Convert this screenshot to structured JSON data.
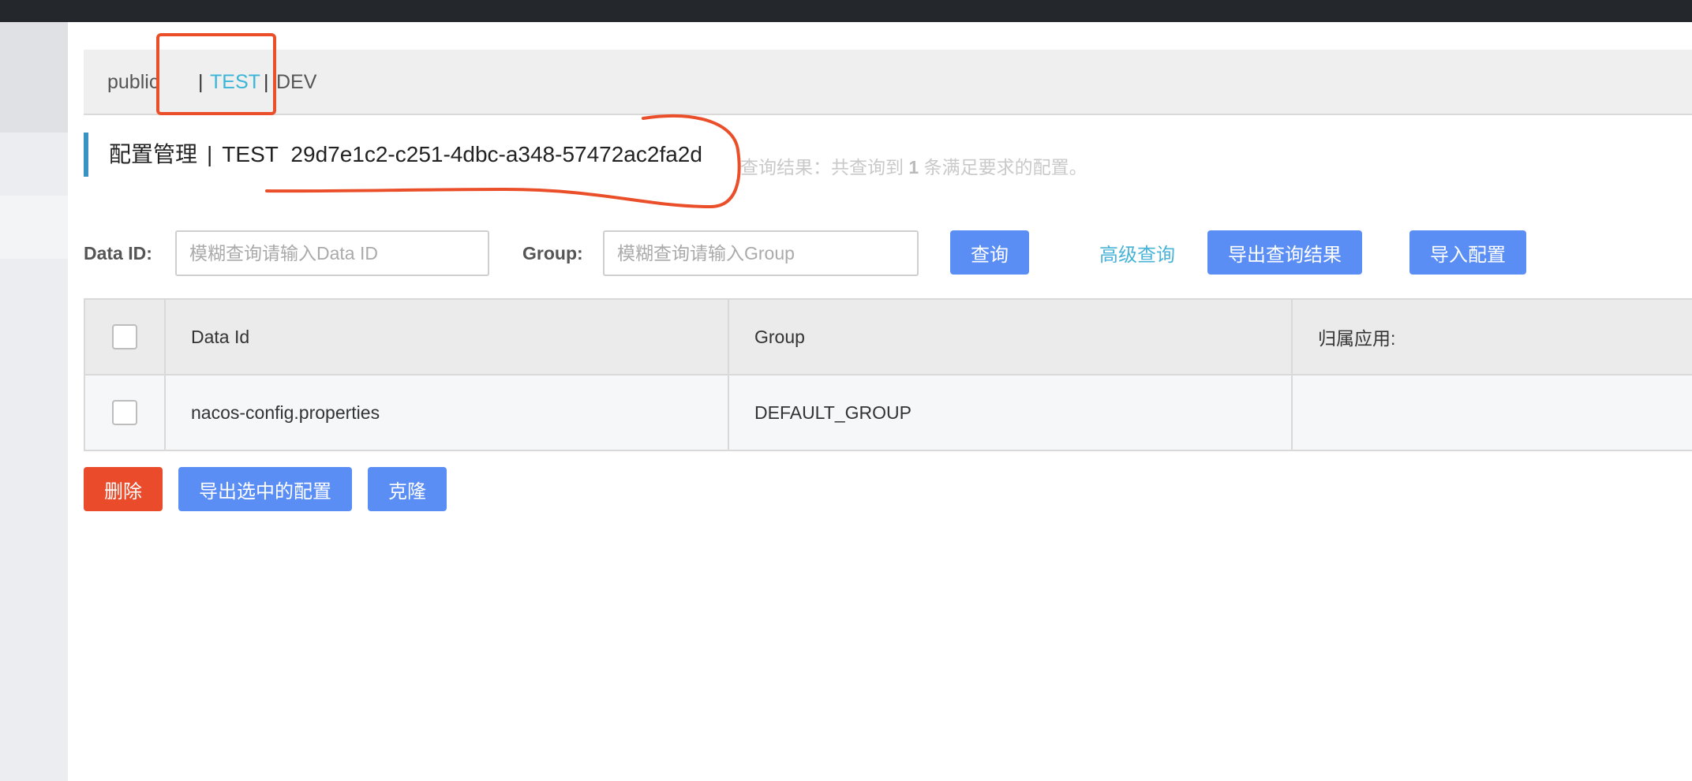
{
  "namespaces": [
    {
      "label": "public",
      "active": false
    },
    {
      "label": "TEST",
      "active": true
    },
    {
      "label": "DEV",
      "active": false
    }
  ],
  "namespace_separator": "|",
  "page_title": {
    "section": "配置管理",
    "separator": "|",
    "namespace": "TEST",
    "namespace_id": "29d7e1c2-c251-4dbc-a348-57472ac2fa2d"
  },
  "query_result": {
    "prefix": "查询结果：共查询到",
    "count": "1",
    "suffix": "条满足要求的配置。"
  },
  "search": {
    "data_id_label": "Data ID:",
    "data_id_placeholder": "模糊查询请输入Data ID",
    "group_label": "Group:",
    "group_placeholder": "模糊查询请输入Group",
    "query_button": "查询",
    "advanced_query": "高级查询",
    "export_results_button": "导出查询结果",
    "import_config_button": "导入配置"
  },
  "table": {
    "columns": [
      "Data Id",
      "Group",
      "归属应用:"
    ],
    "rows": [
      {
        "data_id": "nacos-config.properties",
        "group": "DEFAULT_GROUP",
        "app": ""
      }
    ]
  },
  "actions": {
    "delete_button": "删除",
    "export_selected_button": "导出选中的配置",
    "clone_button": "克隆"
  },
  "colors": {
    "primary": "#5b8ef5",
    "danger": "#ea4b2a",
    "active_tab": "#3ab5d8",
    "annotation": "#ea4f2a"
  }
}
